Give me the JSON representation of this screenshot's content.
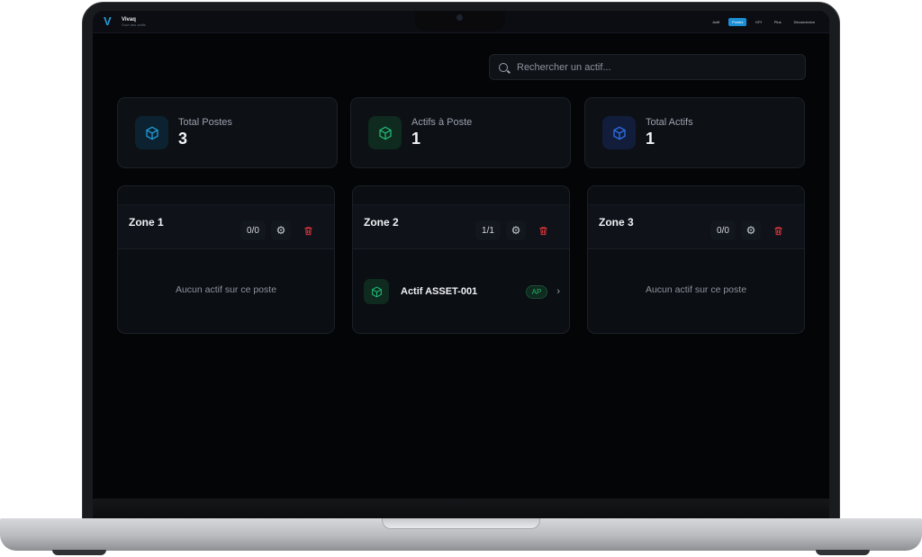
{
  "app": {
    "name": "Vivaq",
    "subtitle": "Suivi des actifs"
  },
  "nav": {
    "items": [
      "Actif",
      "Postes",
      "KPI",
      "Plus",
      "Déconnexion"
    ],
    "active_index": 1
  },
  "search": {
    "placeholder": "Rechercher un actif..."
  },
  "stats": [
    {
      "label": "Total Postes",
      "value": "3",
      "icon": "cube-icon",
      "color": "#1f9bd9"
    },
    {
      "label": "Actifs à Poste",
      "value": "1",
      "icon": "cube-icon",
      "color": "#22b573"
    },
    {
      "label": "Total Actifs",
      "value": "1",
      "icon": "cube-icon",
      "color": "#2f6fe8"
    }
  ],
  "zones": [
    {
      "name": "Zone 1",
      "count": "0/0",
      "empty_text": "Aucun actif sur ce poste"
    },
    {
      "name": "Zone 2",
      "count": "1/1",
      "asset": {
        "name": "Actif ASSET-001",
        "tag": "AP"
      }
    },
    {
      "name": "Zone 3",
      "count": "0/0",
      "empty_text": "Aucun actif sur ce poste"
    }
  ],
  "colors": {
    "accent": "#1b8fd6",
    "danger": "#e0353a",
    "success": "#26b36a"
  }
}
